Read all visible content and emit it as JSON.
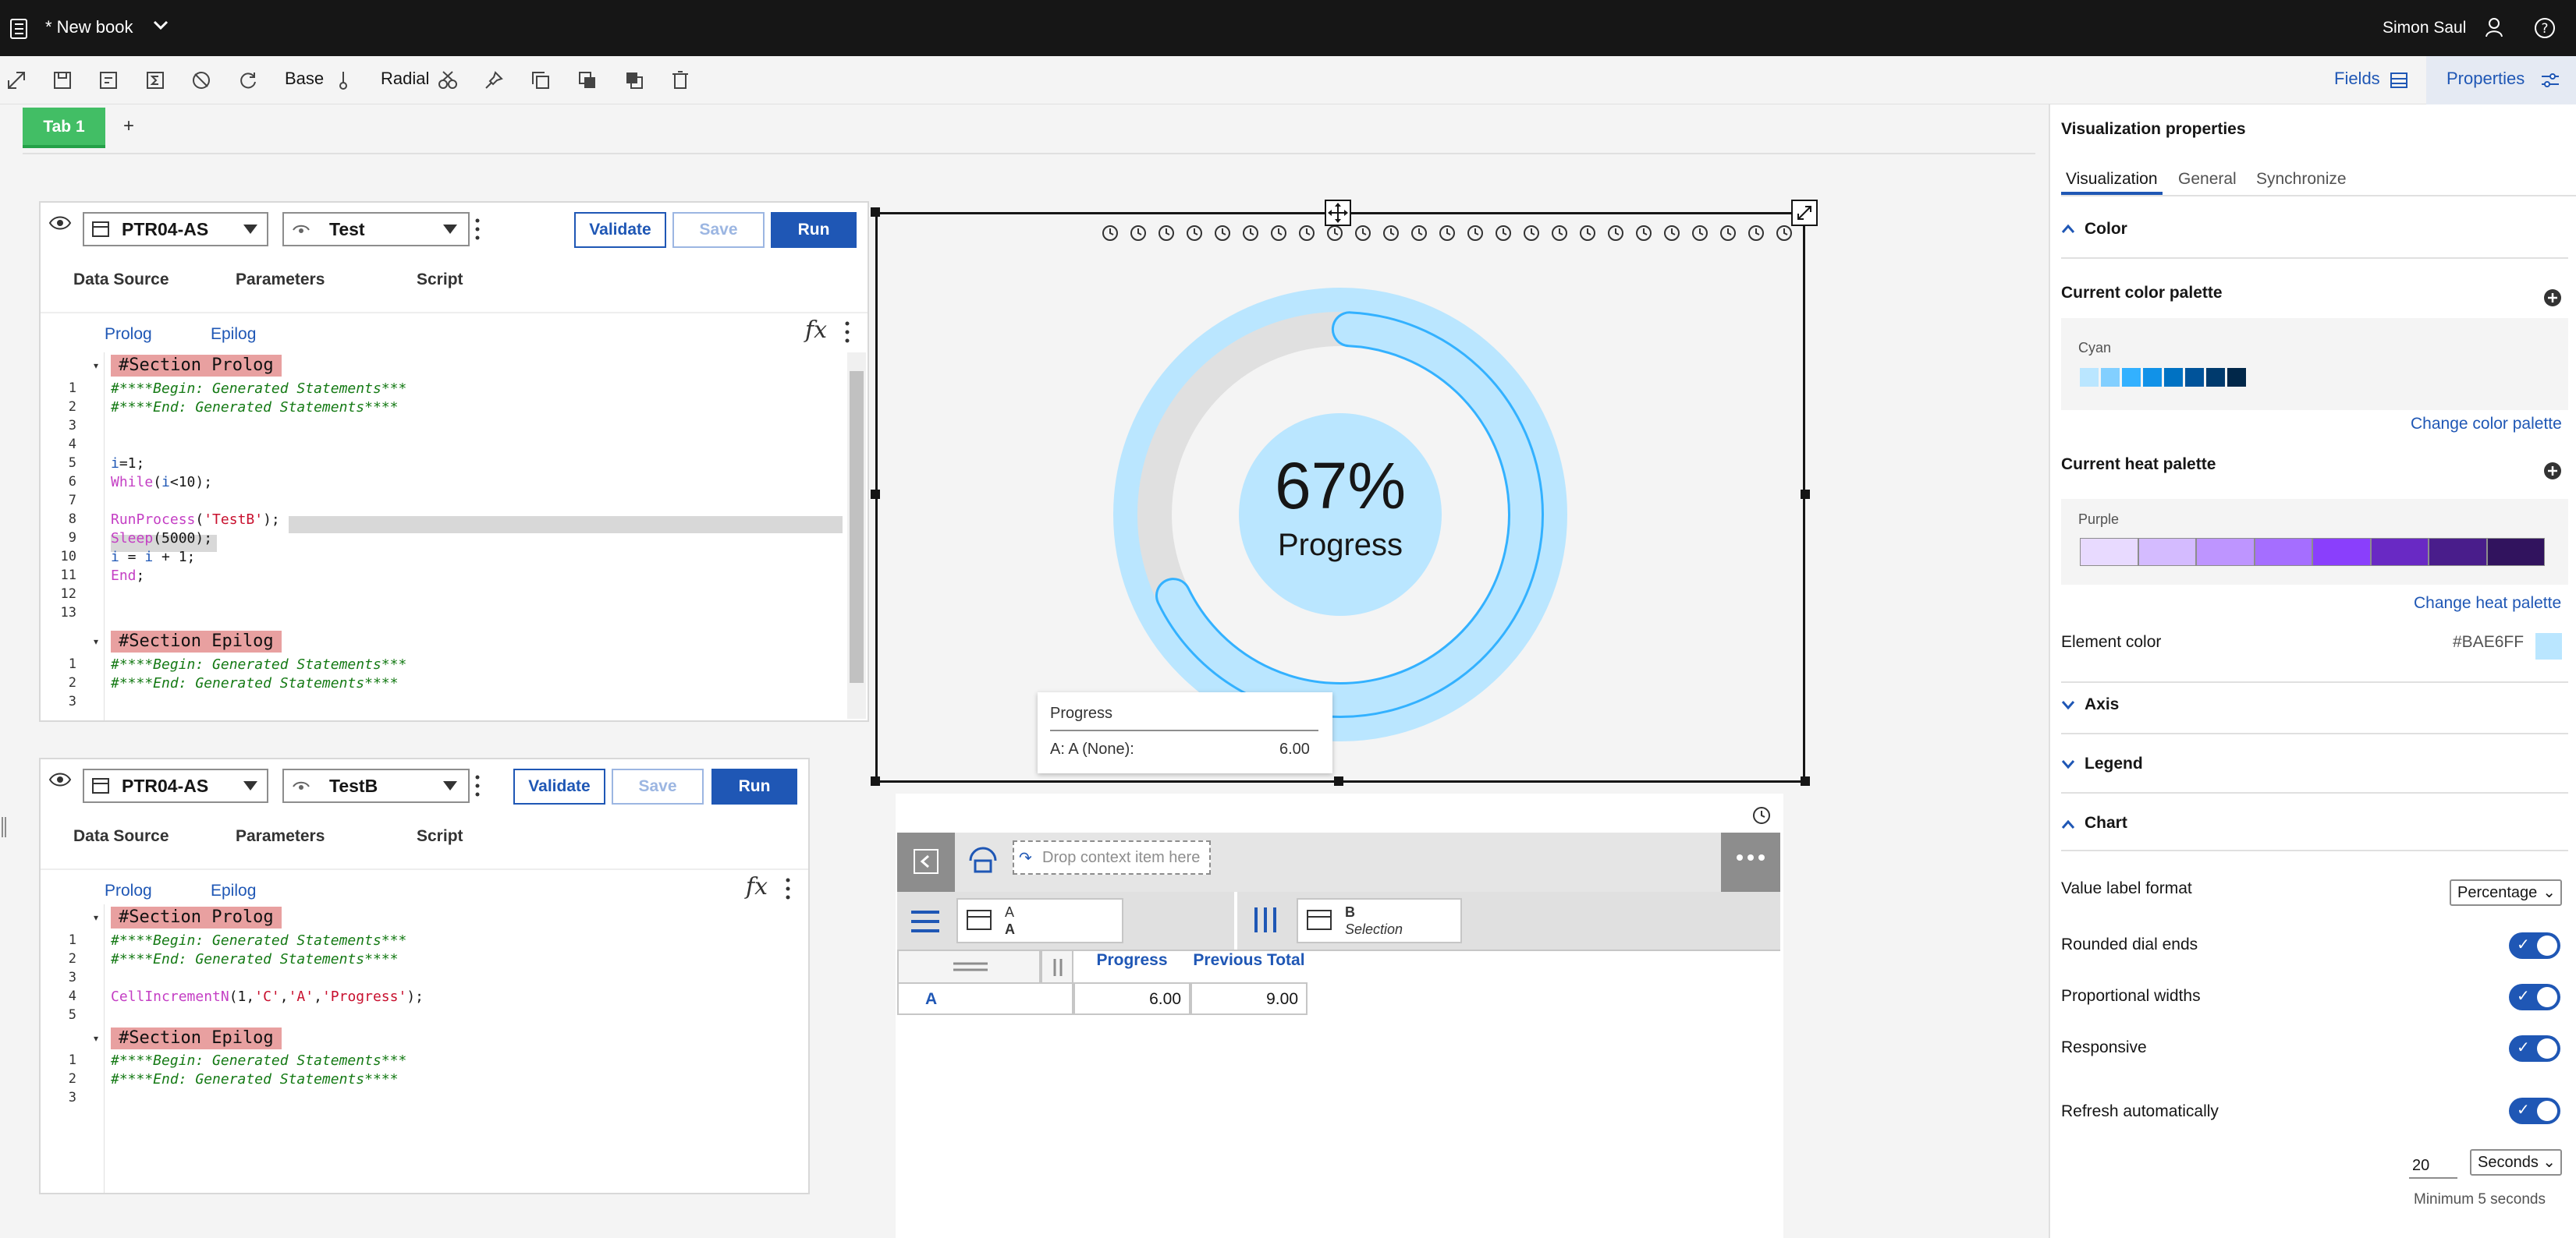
{
  "app": {
    "title": "* New book",
    "user": "Simon Saul"
  },
  "toolbar": {
    "base_label": "Base",
    "radial_label": "Radial",
    "fields_label": "Fields",
    "properties_label": "Properties"
  },
  "tabs": [
    {
      "label": "Tab 1"
    }
  ],
  "add_tab": "+",
  "panel1": {
    "server": "PTR04-AS",
    "process": "Test",
    "validate": "Validate",
    "save": "Save",
    "run": "Run",
    "tabs": [
      "Data Source",
      "Parameters",
      "Script"
    ],
    "subtabs": [
      "Prolog",
      "Epilog"
    ],
    "section_prolog": "#Section Prolog",
    "section_epilog": "#Section Epilog",
    "prolog_lines": [
      "#****Begin: Generated Statements***",
      "#****End: Generated Statements****",
      "",
      "",
      "i=1;",
      "While(i<10);",
      "",
      "RunProcess('TestB');",
      "Sleep(5000);",
      "i = i + 1;",
      "End;",
      "",
      ""
    ],
    "prolog_nums": [
      "1",
      "2",
      "3",
      "4",
      "5",
      "6",
      "7",
      "8",
      "9",
      "10",
      "11",
      "12",
      "13"
    ],
    "epilog_lines": [
      "#****Begin: Generated Statements***",
      "#****End: Generated Statements****",
      ""
    ],
    "epilog_nums": [
      "1",
      "2",
      "3"
    ]
  },
  "panel2": {
    "server": "PTR04-AS",
    "process": "TestB",
    "validate": "Validate",
    "save": "Save",
    "run": "Run",
    "tabs": [
      "Data Source",
      "Parameters",
      "Script"
    ],
    "subtabs": [
      "Prolog",
      "Epilog"
    ],
    "section_prolog": "#Section Prolog",
    "section_epilog": "#Section Epilog",
    "prolog_lines": [
      "#****Begin: Generated Statements***",
      "#****End: Generated Statements****",
      "",
      "CellIncrementN(1,'C','A','Progress');",
      ""
    ],
    "prolog_nums": [
      "1",
      "2",
      "3",
      "4",
      "5"
    ],
    "epilog_lines": [
      "#****Begin: Generated Statements***",
      "#****End: Generated Statements****",
      ""
    ],
    "epilog_nums": [
      "1",
      "2",
      "3"
    ]
  },
  "chart_data": {
    "type": "radial",
    "value": 0.67,
    "value_label": "67%",
    "center_label": "Progress",
    "series": [
      {
        "name": "Progress",
        "value": 6.0
      }
    ],
    "tooltip": {
      "title": "Progress",
      "row_label": "A: A (None):",
      "row_value": "6.00"
    },
    "element_color": "#BAE6FF"
  },
  "exploration": {
    "drop_context": "Drop context item here",
    "rows_dim": {
      "title": "A",
      "sub": "A"
    },
    "cols_dim": {
      "title": "B",
      "sub": "Selection"
    },
    "headers": [
      "Progress",
      "Previous Total"
    ],
    "rows": [
      {
        "label": "A",
        "values": [
          "6.00",
          "9.00"
        ]
      }
    ]
  },
  "properties": {
    "title": "Visualization properties",
    "tabs": [
      "Visualization",
      "General",
      "Synchronize"
    ],
    "color_section": "Color",
    "current_color_palette": "Current color palette",
    "color_palette_name": "Cyan",
    "cyan_swatches": [
      "#bae6ff",
      "#82cfff",
      "#33b1ff",
      "#1192e8",
      "#0072c3",
      "#00539a",
      "#003a6d",
      "#012749"
    ],
    "change_color_palette": "Change color palette",
    "current_heat_palette": "Current heat palette",
    "heat_palette_name": "Purple",
    "purple_swatches": [
      "#e8daff",
      "#d4bbff",
      "#be95ff",
      "#a56eff",
      "#8a3ffc",
      "#6929c4",
      "#491d8b",
      "#31135e"
    ],
    "change_heat_palette": "Change heat palette",
    "element_color_label": "Element color",
    "element_color_value": "#BAE6FF",
    "axis": "Axis",
    "legend": "Legend",
    "chart": "Chart",
    "value_label_format": "Value label format",
    "value_label_format_value": "Percentage",
    "rounded_dial_ends": "Rounded dial ends",
    "proportional_widths": "Proportional widths",
    "responsive": "Responsive",
    "refresh_automatically": "Refresh automatically",
    "refresh_value": "20",
    "refresh_unit": "Seconds",
    "refresh_min": "Minimum 5 seconds"
  },
  "colors": {
    "accent": "#1f57b5",
    "tab_green": "#42be65",
    "header_dark": "#161616"
  }
}
